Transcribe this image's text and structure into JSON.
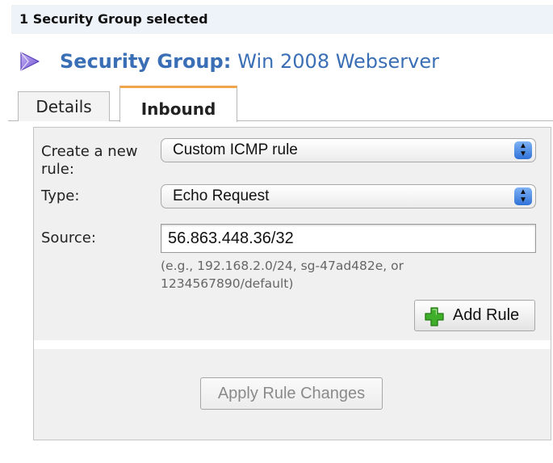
{
  "selection_bar": {
    "text": "1 Security Group selected"
  },
  "title": {
    "label": "Security Group:",
    "name": "Win 2008 Webserver",
    "accent_color": "#3a6fb5",
    "icon": "security-group-gem-icon"
  },
  "tabs": [
    {
      "label": "Details",
      "active": false
    },
    {
      "label": "Inbound",
      "active": true
    }
  ],
  "form": {
    "create_label": "Create a new rule:",
    "create_value": "Custom ICMP rule",
    "type_label": "Type:",
    "type_value": "Echo Request",
    "source_label": "Source:",
    "source_value": "56.863.448.36/32",
    "source_hint": "(e.g., 192.168.2.0/24, sg-47ad482e, or 1234567890/default)",
    "add_rule_label": "Add Rule",
    "add_rule_icon": "green-plus-icon"
  },
  "actions": {
    "apply_label": "Apply Rule Changes",
    "apply_enabled": false
  }
}
